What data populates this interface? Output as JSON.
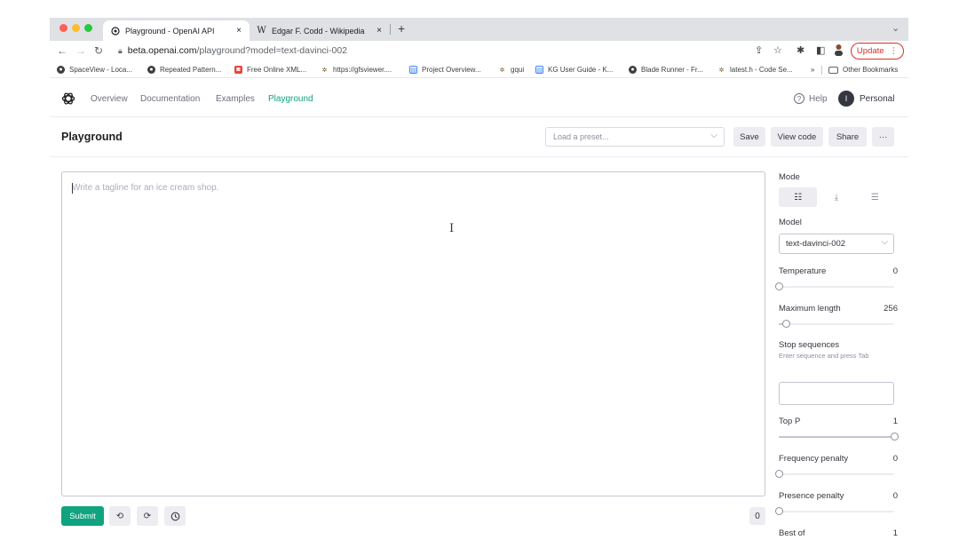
{
  "browser": {
    "tabs": [
      {
        "title": "Playground - OpenAI API",
        "icon": "openai-icon",
        "active": true
      },
      {
        "title": "Edgar F. Codd - Wikipedia",
        "icon": "wikipedia-icon",
        "active": false
      }
    ],
    "new_tab": "+",
    "tab_close": "×",
    "menu_chevron": "⌄",
    "url_host": "beta.openai.com",
    "url_path": "/playground?model=text-davinci-002",
    "update_label": "Update",
    "bookmarks": [
      "SpaceView - Loca...",
      "Repeated Pattern...",
      "Free Online XML...",
      "https://gfsviewer....",
      "Project Overview...",
      "gqui",
      "KG User Guide - K...",
      "Blade Runner - Fr...",
      "latest.h - Code Se..."
    ],
    "bookmarks_overflow": "»",
    "other_bookmarks": "Other Bookmarks"
  },
  "app": {
    "nav": [
      "Overview",
      "Documentation",
      "Examples",
      "Playground"
    ],
    "active_nav": "Playground",
    "help_label": "Help",
    "avatar_initial": "I",
    "account_label": "Personal",
    "accent_color": "#10a37f"
  },
  "page": {
    "title": "Playground",
    "preset_placeholder": "Load a preset...",
    "save_label": "Save",
    "view_code_label": "View code",
    "share_label": "Share",
    "more_label": "···"
  },
  "editor": {
    "placeholder": "Write a tagline for an ice cream shop.",
    "submit_label": "Submit",
    "token_count": "0"
  },
  "settings": {
    "mode_label": "Mode",
    "mode_selected": "complete",
    "model_label": "Model",
    "model_value": "text-davinci-002",
    "temperature_label": "Temperature",
    "temperature_value": "0",
    "temperature_fraction": 0.0,
    "max_length_label": "Maximum length",
    "max_length_value": "256",
    "max_length_fraction": 0.06,
    "stop_label": "Stop sequences",
    "stop_hint": "Enter sequence and press Tab",
    "top_p_label": "Top P",
    "top_p_value": "1",
    "top_p_fraction": 1.0,
    "freq_label": "Frequency penalty",
    "freq_value": "0",
    "freq_fraction": 0.0,
    "presence_label": "Presence penalty",
    "presence_value": "0",
    "presence_fraction": 0.0,
    "best_of_label": "Best of",
    "best_of_value": "1",
    "best_of_fraction": 0.0
  }
}
